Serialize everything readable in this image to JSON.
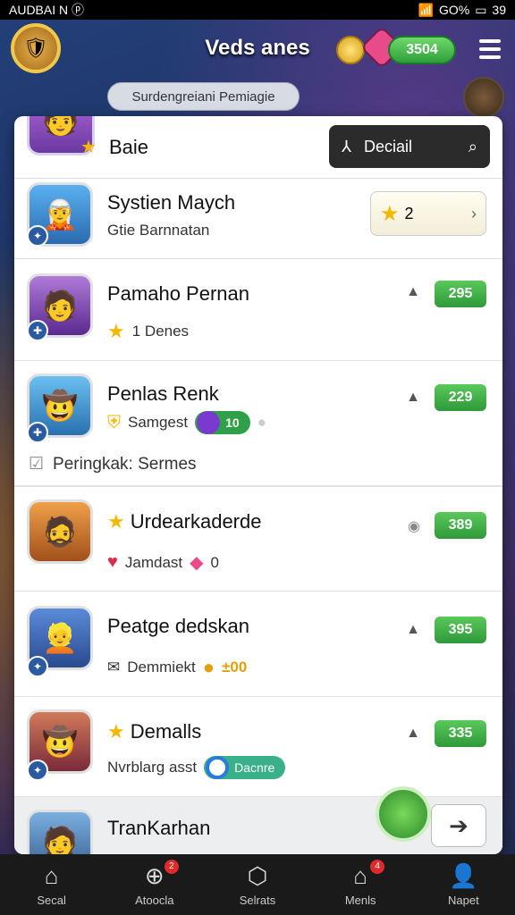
{
  "status": {
    "left": "AUDBAI N ⓟ",
    "battery": "GO%",
    "time": "39"
  },
  "header": {
    "title": "Veds anes",
    "currency_value": "3504"
  },
  "banner": {
    "text": "Surdengreiani Pemiagie"
  },
  "panel": {
    "title": "Baie",
    "detail_label": "Deciail"
  },
  "rows": [
    {
      "name": "Systien Maych",
      "sub": "Gtie Barnnatan",
      "rank": "2"
    },
    {
      "name": "Pamaho Pernan",
      "sub": "1 Denes",
      "score": "295"
    },
    {
      "name": "Penlas Renk",
      "sub": "Samgest",
      "pill": "10",
      "score": "229"
    },
    {
      "name": "Urdearkaderde",
      "sub": "Jamdast",
      "sub2": "0",
      "score": "389"
    },
    {
      "name": "Peatge dedskan",
      "sub": "Demmiekt",
      "sub2": "±00",
      "score": "395"
    },
    {
      "name": "Demalls",
      "sub": "Nvrblarg asst",
      "pill": "Dacnre",
      "score": "335"
    },
    {
      "name": "TranKarhan"
    }
  ],
  "section": {
    "label": "Peringkak: Sermes"
  },
  "nav": [
    {
      "label": "Secal",
      "icon": "home-icon"
    },
    {
      "label": "Atoocla",
      "icon": "add-circle-icon",
      "badge": "2"
    },
    {
      "label": "Selrats",
      "icon": "box-icon"
    },
    {
      "label": "Menls",
      "icon": "house-icon",
      "badge": "4"
    },
    {
      "label": "Napet",
      "icon": "person-icon"
    }
  ],
  "colors": {
    "accent_green": "#2e9a3a",
    "gold": "#f5b800",
    "dark_button": "#2b2b2b"
  }
}
